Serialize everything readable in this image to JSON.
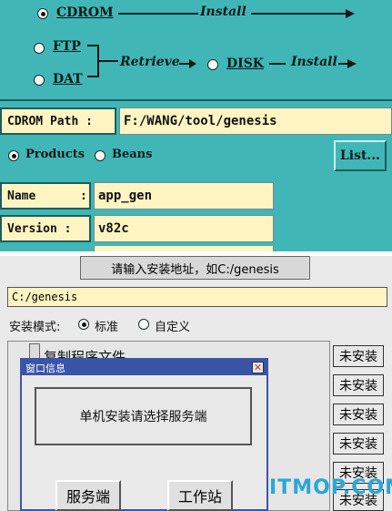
{
  "top_panel": {
    "source_cdrom": "CDROM",
    "source_ftp": "FTP",
    "source_dat": "DAT",
    "install_label_1": "Install",
    "retrieve_label": "Retrieve",
    "target_disk": "DISK",
    "install_label_2": "Install",
    "cdrom_path_label": "CDROM Path :",
    "cdrom_path_value": "F:/WANG/tool/genesis",
    "mode_products": "Products",
    "mode_beans": "Beans",
    "list_button": "List...",
    "name_label": "Name",
    "name_colon": ":",
    "name_value": "app_gen",
    "version_label": "Version :",
    "version_value": "v82c",
    "selected_source": "CDROM",
    "selected_mode": "Products"
  },
  "bottom_panel": {
    "prompt_text": "请输入安装地址，如C:/genesis",
    "path_value": "C:/genesis",
    "mode_label": "安装模式:",
    "mode_standard": "标准",
    "mode_custom": "自定义",
    "selected_mode": "标准",
    "partial_row_label": "复制程序文件",
    "status_items": [
      "未安装",
      "未安装",
      "未安装",
      "未安装",
      "未安装",
      "未安装",
      "未安装"
    ],
    "dialog": {
      "title": "窗口信息",
      "message": "单机安装请选择服务端",
      "server_button": "服务端",
      "workstation_button": "工作站"
    },
    "watermark": "ITMOP.COM"
  },
  "colors": {
    "panel_teal": "#41b6b6",
    "field_yellow": "#fff5c2",
    "dialog_blue": "#3a55a8",
    "watermark_blue": "#2aa6d8"
  }
}
